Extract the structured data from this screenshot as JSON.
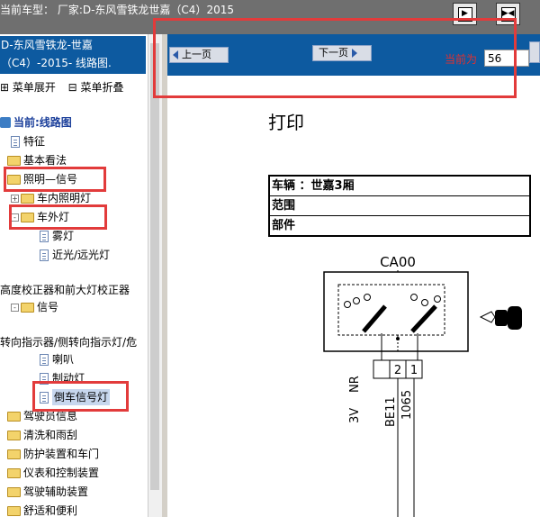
{
  "titlebar": {
    "title": "当前车型：  厂家:D-东风雪铁龙世嘉（C4）2015"
  },
  "toolbar": {
    "btn1_glyph": "▶",
    "btn2_glyph": "▶◀"
  },
  "left_panel": {
    "header_line1": "D-东风雪铁龙-世嘉",
    "header_line2": "（C4）-2015- 线路图.",
    "expand_label": "菜单展开",
    "collapse_label": "菜单折叠",
    "expand_glyph": "⊞",
    "collapse_glyph": "⊟",
    "tree": [
      {
        "label": "当前:线路图",
        "icon": "root-icon"
      },
      {
        "label": "特征",
        "icon": "document-icon"
      },
      {
        "label": "基本看法",
        "icon": "folder-icon"
      },
      {
        "label": "照明—信号",
        "icon": "folder-icon"
      },
      {
        "label": "车内照明灯",
        "icon": "folder-icon",
        "toggle": "+"
      },
      {
        "label": "车外灯",
        "icon": "folder-icon",
        "toggle": "-"
      },
      {
        "label": "雾灯",
        "icon": "document-icon"
      },
      {
        "label": "近光/远光灯",
        "icon": "document-icon"
      },
      {
        "label": "高度校正器和前大灯校正器",
        "icon": "none"
      },
      {
        "label": "信号",
        "icon": "folder-icon",
        "toggle": "-"
      },
      {
        "label": "转向指示器/侧转向指示灯/危",
        "icon": "none"
      },
      {
        "label": "喇叭",
        "icon": "document-icon"
      },
      {
        "label": "制动灯",
        "icon": "document-icon"
      },
      {
        "label": "倒车信号灯",
        "icon": "document-icon"
      },
      {
        "label": "驾驶员信息",
        "icon": "folder-icon"
      },
      {
        "label": "清洗和雨刮",
        "icon": "folder-icon"
      },
      {
        "label": "防护装置和车门",
        "icon": "folder-icon"
      },
      {
        "label": "仪表和控制装置",
        "icon": "folder-icon"
      },
      {
        "label": "驾驶辅助装置",
        "icon": "folder-icon"
      },
      {
        "label": "舒适和便利",
        "icon": "folder-icon"
      }
    ]
  },
  "nav": {
    "prev_label": "上一页",
    "next_label": "下一页",
    "current_label": "当前为",
    "current_page": "56"
  },
  "document": {
    "print_title": "打印",
    "rows": [
      "车辆 ：世嘉3厢",
      "范围",
      "部件"
    ]
  },
  "diagram": {
    "connector_title": "CA00",
    "pins": [
      "2",
      "1"
    ],
    "wire_labels": [
      "3V",
      "NR",
      "BE11",
      "1065"
    ]
  },
  "colors": {
    "header_blue": "#0d5aa0",
    "highlight_red": "#e23b3b",
    "current_label_red": "#e03030"
  }
}
